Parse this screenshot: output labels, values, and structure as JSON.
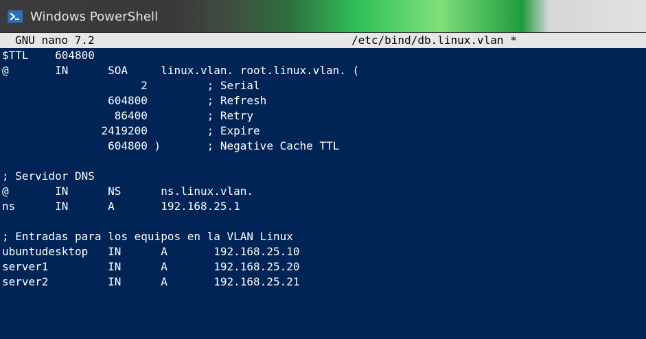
{
  "window": {
    "title": "Windows PowerShell",
    "icon": "powershell-icon"
  },
  "nano": {
    "version": "GNU nano 7.2",
    "filename": "/etc/bind/db.linux.vlan *"
  },
  "lines": [
    "$TTL    604800",
    "@       IN      SOA     linux.vlan. root.linux.vlan. (",
    "                     2         ; Serial",
    "                604800         ; Refresh",
    "                 86400         ; Retry",
    "               2419200         ; Expire",
    "                604800 )       ; Negative Cache TTL",
    "",
    "; Servidor DNS",
    "@       IN      NS      ns.linux.vlan.",
    "ns      IN      A       192.168.25.1",
    "",
    "; Entradas para los equipos en la VLAN Linux",
    "ubuntudesktop   IN      A       192.168.25.10",
    "server1         IN      A       192.168.25.20",
    "server2         IN      A       192.168.25.21"
  ],
  "colors": {
    "background": "#012456",
    "text": "#ffffff",
    "nano_header_bg": "#e6e6e6"
  }
}
